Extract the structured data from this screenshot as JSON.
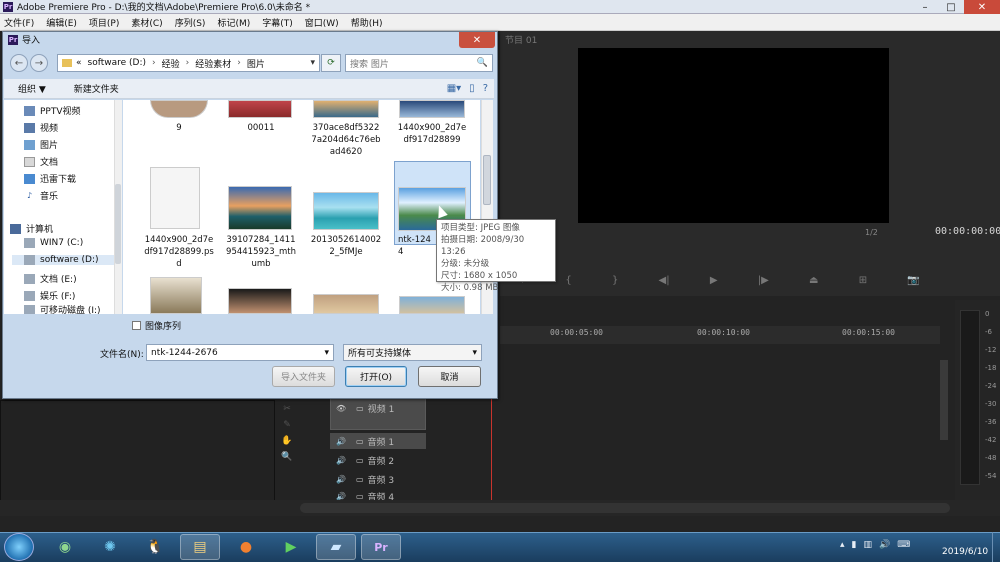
{
  "window": {
    "title": "Adobe Premiere Pro - D:\\我的文档\\Adobe\\Premiere Pro\\6.0\\未命名 *",
    "min": "–",
    "max": "□",
    "close": "✕"
  },
  "menu": [
    "文件(F)",
    "编辑(E)",
    "项目(P)",
    "素材(C)",
    "序列(S)",
    "标记(M)",
    "字幕(T)",
    "窗口(W)",
    "帮助(H)"
  ],
  "monitor": {
    "tab": "节目 01",
    "timecode_left": "1/2",
    "timecode": "00:00:00:00"
  },
  "timeline": {
    "marks": [
      "00:00:05:00",
      "00:00:10:00",
      "00:00:15:00"
    ]
  },
  "tracks": [
    {
      "name": "视频 1",
      "icon": "eye-icon"
    },
    {
      "name": "音频 1",
      "icon": "speaker-icon"
    },
    {
      "name": "音频 2",
      "icon": "speaker-icon"
    },
    {
      "name": "音频 3",
      "icon": "speaker-icon"
    },
    {
      "name": "音频 4",
      "icon": "speaker-icon"
    }
  ],
  "meter_db": [
    "0",
    "-6",
    "-12",
    "-18",
    "-24",
    "-30",
    "-36",
    "-42",
    "-48",
    "-54"
  ],
  "dialog": {
    "title": "导入",
    "address": {
      "prefix": "«",
      "segments": [
        "software (D:)",
        "经验",
        "经验素材",
        "图片"
      ]
    },
    "search_placeholder": "搜索 图片",
    "toolbar": {
      "organize": "组织 ▼",
      "new_folder": "新建文件夹"
    },
    "nav": [
      {
        "label": "PPTV视频",
        "icon": "video-folder-icon"
      },
      {
        "label": "视频",
        "icon": "video-icon"
      },
      {
        "label": "图片",
        "icon": "picture-icon"
      },
      {
        "label": "文档",
        "icon": "document-icon"
      },
      {
        "label": "迅雷下载",
        "icon": "download-icon"
      },
      {
        "label": "音乐",
        "icon": "music-icon"
      },
      {
        "label": "计算机",
        "icon": "computer-icon"
      },
      {
        "label": "WIN7 (C:)",
        "icon": "drive-icon"
      },
      {
        "label": "software (D:)",
        "icon": "drive-icon"
      },
      {
        "label": "文档 (E:)",
        "icon": "drive-icon"
      },
      {
        "label": "娱乐 (F:)",
        "icon": "drive-icon"
      },
      {
        "label": "可移动磁盘 (I:)",
        "icon": "usb-drive-icon"
      }
    ],
    "files_row1": [
      "9",
      "00011",
      "370ace8df5322\n7a204d64c76eb\nad4620",
      "1440x900_2d7e\ndf917d28899"
    ],
    "files_row2": [
      "1440x900_2d7e\ndf917d28899.ps\nd",
      "39107284_1411\n954415923_mth\numb",
      "2013052614002\n2_5fMJe",
      "ntk-1244"
    ],
    "tooltip": [
      "项目类型: JPEG 图像",
      "拍摄日期: 2008/9/30 13:26",
      "分级: 未分级",
      "尺寸: 1680 x 1050",
      "大小: 0.98 MB"
    ],
    "image_sequence": "图像序列",
    "filename_label": "文件名(N):",
    "filename_value": "ntk-1244-2676",
    "filetype": "所有可支持媒体",
    "btn_import_folder": "导入文件夹",
    "btn_open": "打开(O)",
    "btn_cancel": "取消"
  },
  "taskbar": {
    "apps": [
      "ie-icon",
      "360-icon",
      "qq-icon",
      "explorer-icon",
      "firefox-icon",
      "media-icon",
      "app-icon",
      "premiere-icon"
    ],
    "clock_date": "2019/6/10"
  }
}
